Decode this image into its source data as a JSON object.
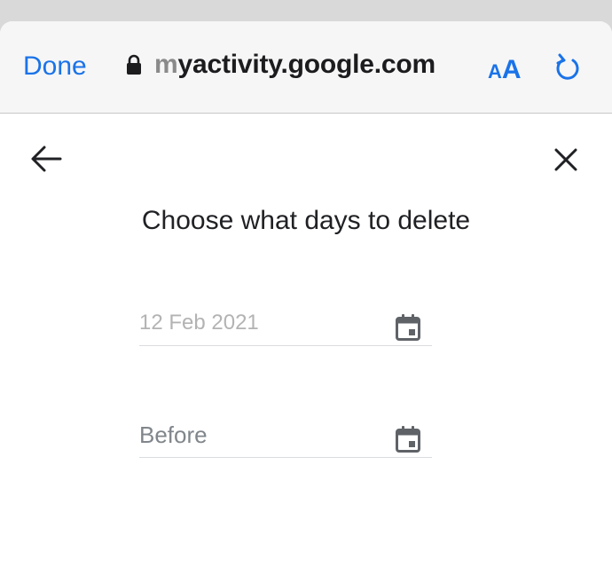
{
  "browser": {
    "done_label": "Done",
    "url_faded": "m",
    "url_main": "yactivity.google.com",
    "text_size_small": "A",
    "text_size_large": "A"
  },
  "dialog": {
    "title": "Choose what days to delete",
    "after_field": {
      "value": "12 Feb 2021"
    },
    "before_field": {
      "placeholder": "Before"
    }
  },
  "colors": {
    "accent": "#1a73e8",
    "icon": "#202124",
    "calendar_icon": "#5f6368"
  },
  "icons": [
    "lock-icon",
    "reload-icon",
    "back-arrow-icon",
    "close-icon",
    "calendar-icon"
  ]
}
